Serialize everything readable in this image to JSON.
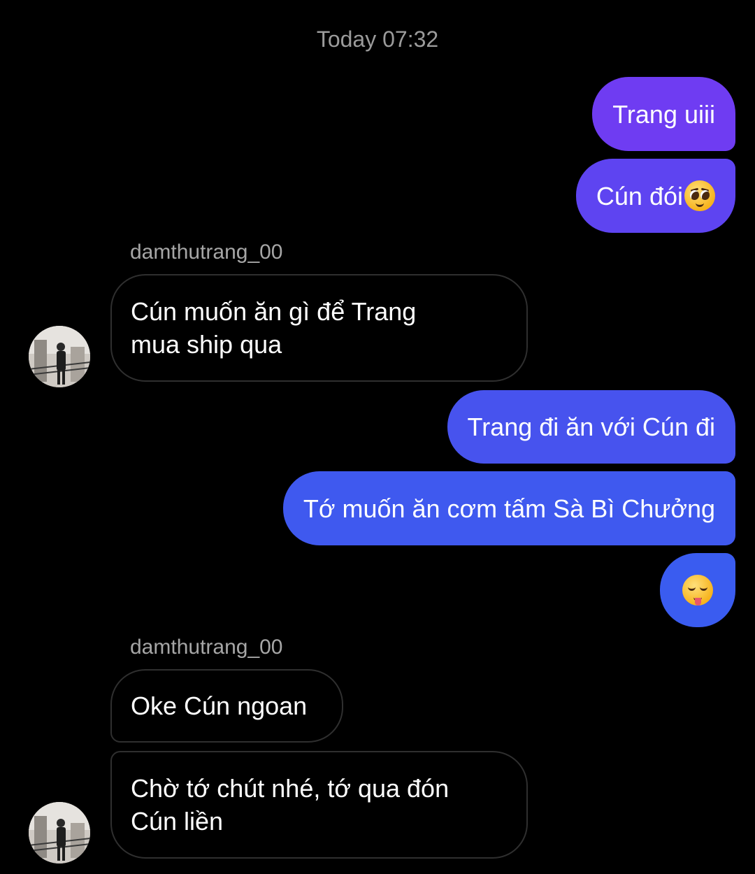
{
  "header": {
    "timestamp": "Today 07:32"
  },
  "colors": {
    "outgoing_gradient_top": "#7d3cf0",
    "outgoing_gradient_bottom": "#3d5cf0",
    "incoming_border": "#2f2f2f",
    "background": "#000000"
  },
  "messages": [
    {
      "direction": "out",
      "text": "Trang uiii"
    },
    {
      "direction": "out",
      "text": "Cún đói",
      "emoji": "pleading-face-emoji"
    },
    {
      "direction": "in",
      "sender": "damthutrang_00",
      "text": "Cún muốn ăn gì để Trang mua ship qua",
      "lines": [
        "Cún muốn ăn gì để Trang",
        "mua ship qua"
      ]
    },
    {
      "direction": "out",
      "text": "Trang đi ăn với Cún đi"
    },
    {
      "direction": "out",
      "text": "Tớ muốn ăn cơm tấm Sà Bì Chưởng"
    },
    {
      "direction": "out",
      "text": "",
      "emoji": "drooling-face-emoji"
    },
    {
      "direction": "in",
      "sender": "damthutrang_00",
      "text": "Oke Cún ngoan"
    },
    {
      "direction": "in",
      "text": "Chờ tớ chút nhé, tớ qua đón Cún liền",
      "lines": [
        "Chờ tớ chút nhé, tớ qua đón",
        "Cún liền"
      ]
    }
  ]
}
